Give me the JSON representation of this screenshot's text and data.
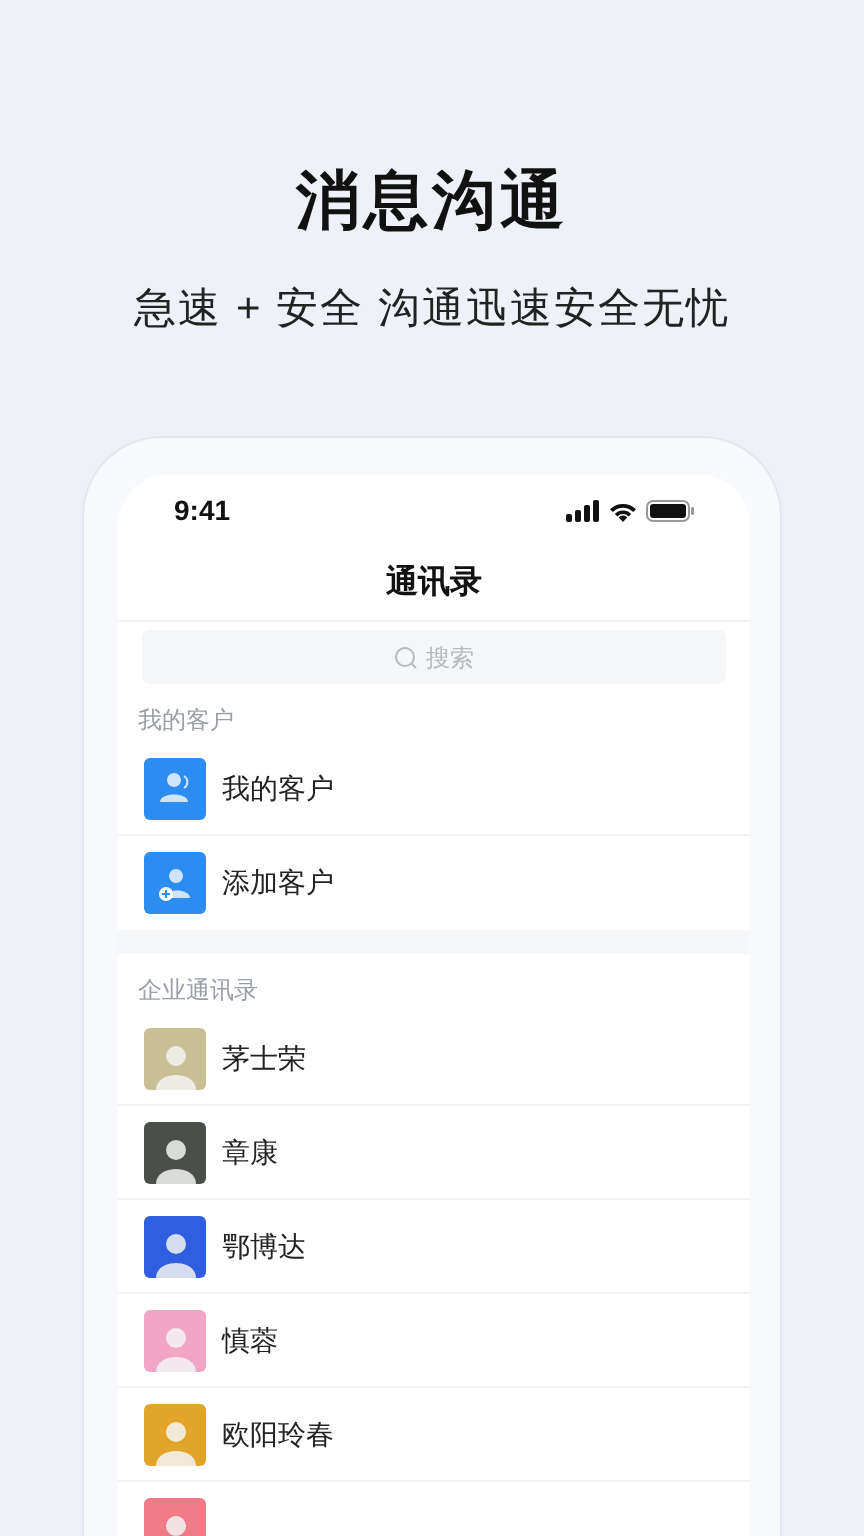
{
  "headline": "消息沟通",
  "subtitle": "急速 + 安全 沟通迅速安全无忧",
  "phone": {
    "status_bar": {
      "time": "9:41"
    },
    "title": "通讯录",
    "search": {
      "placeholder": "搜索"
    },
    "sections": [
      {
        "label": "我的客户",
        "items": [
          {
            "kind": "group",
            "name": "我的客户"
          },
          {
            "kind": "add",
            "name": "添加客户"
          }
        ]
      },
      {
        "label": "企业通讯录",
        "items": [
          {
            "kind": "contact",
            "name": "茅士荣",
            "color": "#c9bf95"
          },
          {
            "kind": "contact",
            "name": "章康",
            "color": "#4a4f4a"
          },
          {
            "kind": "contact",
            "name": "鄂博达",
            "color": "#2f5fe0"
          },
          {
            "kind": "contact",
            "name": "慎蓉",
            "color": "#f2a6c6"
          },
          {
            "kind": "contact",
            "name": "欧阳玲春",
            "color": "#e2a52b"
          },
          {
            "kind": "contact",
            "color": "#f07a86"
          }
        ]
      }
    ]
  }
}
